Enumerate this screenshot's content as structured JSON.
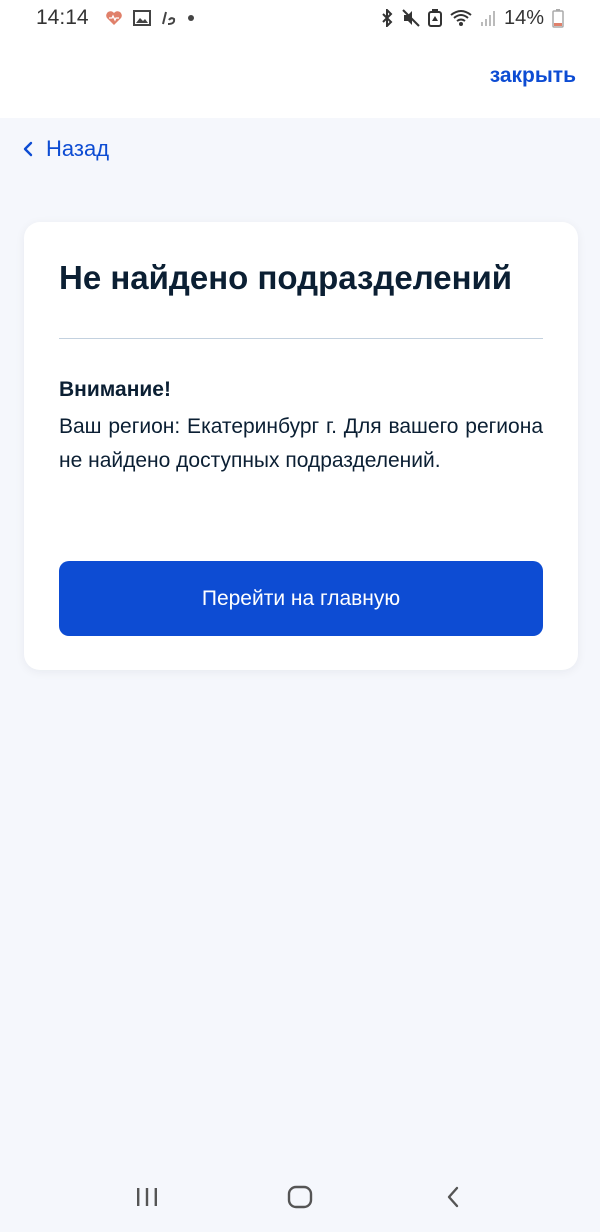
{
  "status_bar": {
    "time": "14:14",
    "battery": "14%",
    "icons_left": [
      "heart-icon",
      "image-icon",
      "app-icon",
      "dot-icon"
    ],
    "icons_right": [
      "bluetooth-icon",
      "mute-icon",
      "battery-saver-icon",
      "wifi-icon",
      "signal-icon",
      "battery-icon"
    ]
  },
  "header": {
    "close_label": "закрыть",
    "back_label": "Назад"
  },
  "card": {
    "title": "Не найдено подразделений",
    "warning_title": "Внимание!",
    "warning_text": "Ваш регион: Екатеринбург г. Для вашего региона не найдено доступных подразделений.",
    "button_label": "Перейти на главную"
  },
  "colors": {
    "accent": "#0d4cd3",
    "background": "#f5f7fc",
    "text": "#0b1f33",
    "card": "#ffffff"
  },
  "nav_bar": {
    "icons": [
      "recent-apps-icon",
      "home-icon",
      "back-icon"
    ]
  }
}
